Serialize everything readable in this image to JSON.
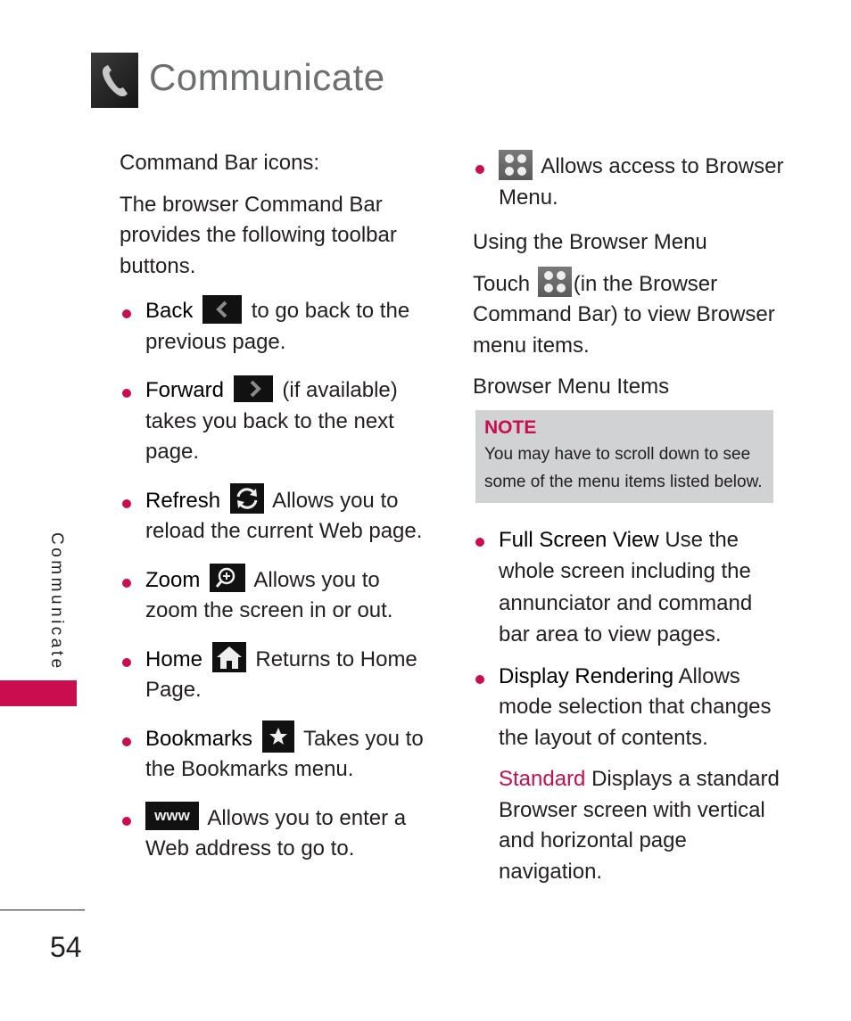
{
  "header": {
    "title": "Communicate",
    "icon": "phone-handset-icon"
  },
  "sidebar": {
    "section_label": "Communicate",
    "accent_color": "#c90d4f"
  },
  "footer": {
    "page_number": "54"
  },
  "left_column": {
    "heading": "Command Bar icons:",
    "intro": "The browser Command Bar provides the following toolbar buttons.",
    "items": [
      {
        "term": "Back",
        "icon": "back-arrow-icon",
        "text": "to go back to the previous page."
      },
      {
        "term": "Forward",
        "icon": "forward-arrow-icon",
        "text": "(if available) takes you back to the next page."
      },
      {
        "term": "Refresh",
        "icon": "refresh-icon",
        "text": "Allows you to reload the current Web page."
      },
      {
        "term": "Zoom",
        "icon": "zoom-in-icon",
        "text": "Allows you to zoom the screen in or out."
      },
      {
        "term": "Home",
        "icon": "home-icon",
        "text": "Returns to Home Page."
      },
      {
        "term": "Bookmarks",
        "icon": "star-icon",
        "text": "Takes you to the Bookmarks menu."
      },
      {
        "term": "",
        "icon": "www-icon",
        "icon_label": "www",
        "text": "Allows you to enter a Web address to go to."
      }
    ]
  },
  "right_column": {
    "menu_item": {
      "icon": "browser-menu-icon",
      "text": "Allows access to Browser Menu."
    },
    "using_heading": "Using the Browser Menu",
    "using_text_before": "Touch",
    "using_text_after": "(in the Browser Command Bar) to view Browser menu items.",
    "items_heading": "Browser Menu Items",
    "note": {
      "title": "NOTE",
      "text": "You may have to scroll down to see some of the menu items listed below."
    },
    "items": [
      {
        "term": "Full Screen View",
        "text": "Use the whole screen including the annunciator and command bar area to view pages."
      },
      {
        "term": "Display Rendering",
        "text": "Allows mode selection that changes the layout of contents."
      }
    ],
    "sub_item": {
      "term": "Standard",
      "text": "Displays a standard Browser screen with vertical and horizontal page navigation."
    }
  }
}
